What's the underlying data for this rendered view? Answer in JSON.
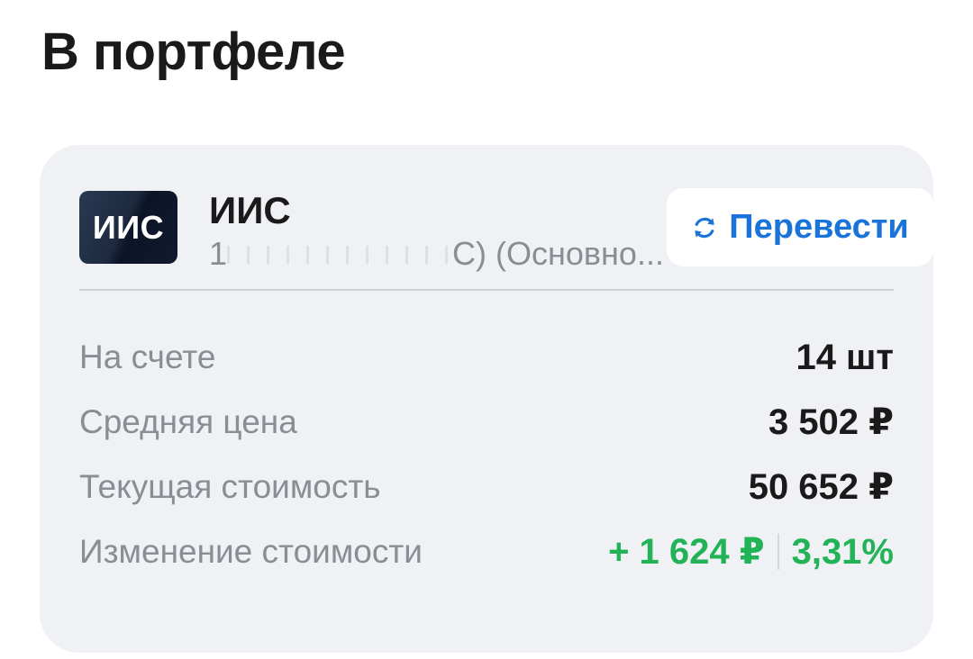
{
  "header": {
    "title": "В портфеле"
  },
  "account": {
    "logo_text": "ИИС",
    "name": "ИИС",
    "subtitle_prefix": "1",
    "subtitle_suffix": "С) (Основно...",
    "transfer_label": "Перевести",
    "icons": {
      "transfer": "refresh-icon"
    }
  },
  "details": {
    "rows": [
      {
        "label": "На счете",
        "value": "14 шт"
      },
      {
        "label": "Средняя цена",
        "value": "3 502 ₽"
      },
      {
        "label": "Текущая стоимость",
        "value": "50 652 ₽"
      },
      {
        "label": "Изменение стоимости",
        "value_abs": "+ 1 624 ₽",
        "value_pct": "3,31%"
      }
    ]
  },
  "colors": {
    "accent": "#1a73d9",
    "positive": "#21b356",
    "card_bg": "#f0f1f5",
    "muted_text": "#8a8d93"
  }
}
